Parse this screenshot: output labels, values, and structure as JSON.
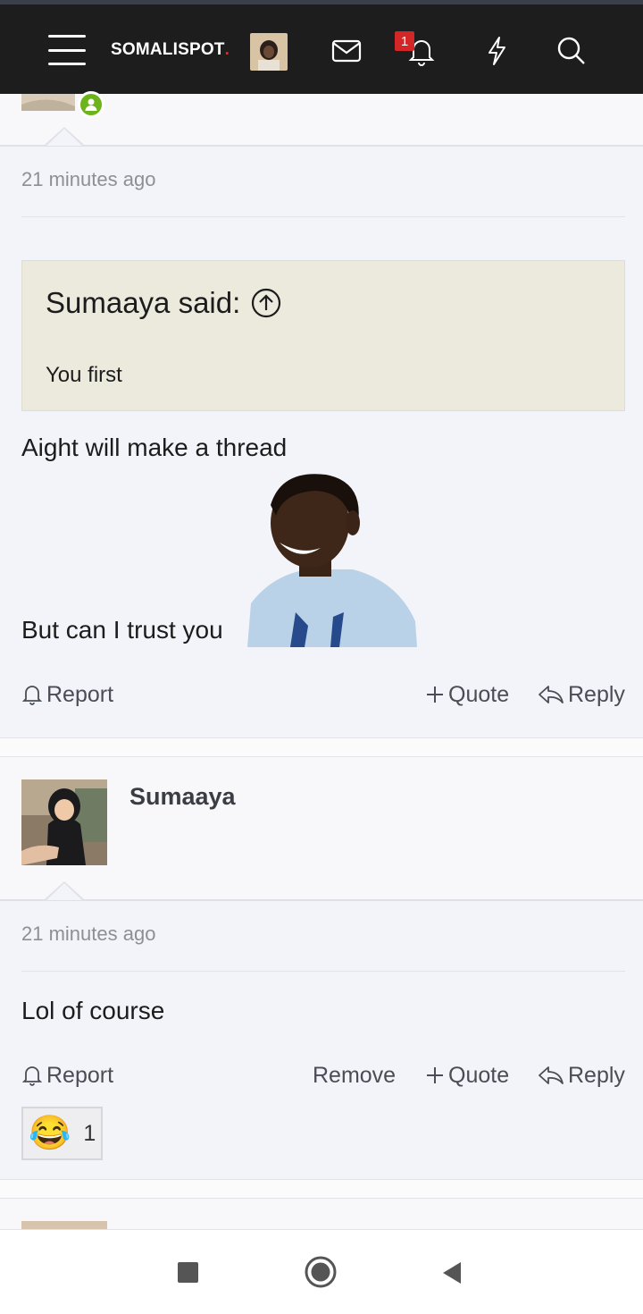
{
  "app": {
    "logo_text": "SOMALISPOT",
    "logo_dot": "."
  },
  "topbar": {
    "notification_count": "1",
    "icons": [
      "menu-icon",
      "mail-icon",
      "bell-icon",
      "bolt-icon",
      "search-icon"
    ]
  },
  "post1": {
    "timestamp": "21 minutes ago",
    "quote": {
      "author_label": "Sumaaya said:",
      "text": "You first"
    },
    "line1": "Aight will make a thread",
    "line2": "But can I trust you",
    "actions": {
      "report": "Report",
      "quote": "Quote",
      "reply": "Reply"
    }
  },
  "post2": {
    "username": "Sumaaya",
    "timestamp": "21 minutes ago",
    "text": "Lol of course",
    "actions": {
      "report": "Report",
      "remove": "Remove",
      "quote": "Quote",
      "reply": "Reply"
    },
    "reaction": {
      "emoji": "😂",
      "count": "1"
    }
  },
  "colors": {
    "topbar": "#1d1d1d",
    "badge": "#d32626",
    "quote_bg": "#ece9dd",
    "online": "#6cb31c"
  }
}
